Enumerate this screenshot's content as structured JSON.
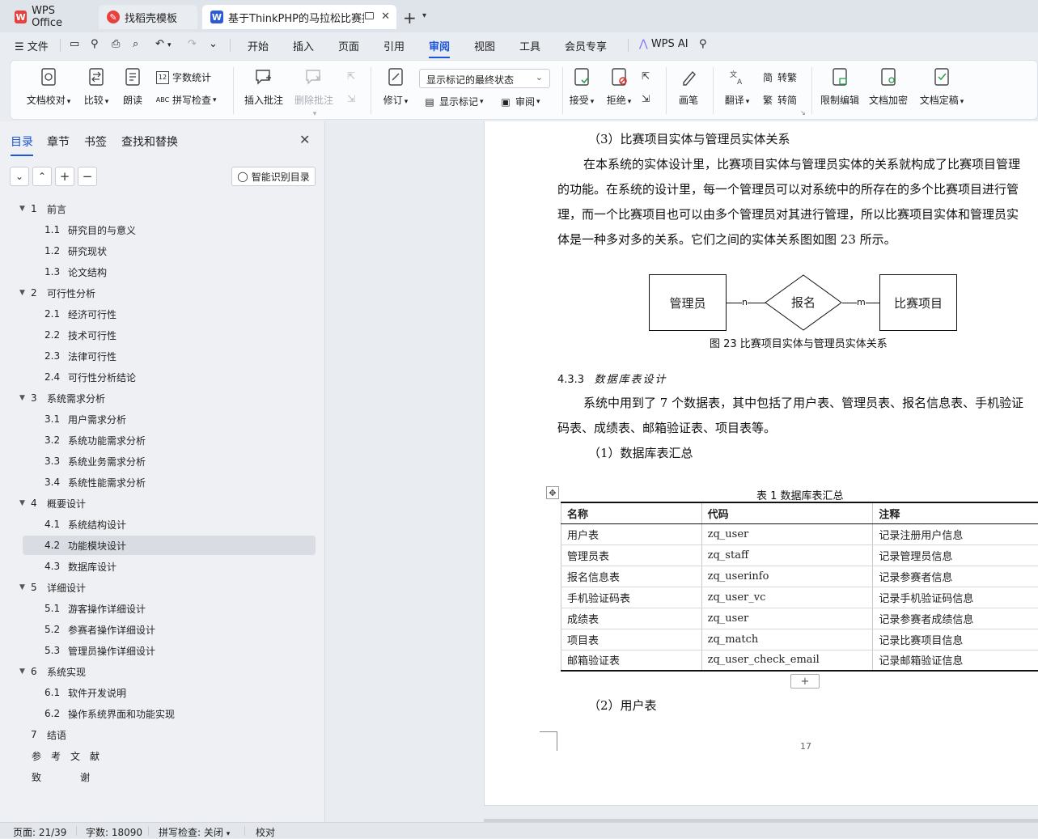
{
  "tabs": [
    {
      "label": "WPS Office",
      "icon": "wps-logo-icon",
      "color": "#e8413c"
    },
    {
      "label": "找稻壳模板",
      "icon": "docer-icon",
      "color": "#e8413c"
    },
    {
      "label": "基于ThinkPHP的马拉松比赛报",
      "icon": "word-doc-icon",
      "color": "#2b5bd7"
    }
  ],
  "menu": {
    "file": "文件",
    "items": [
      "开始",
      "插入",
      "页面",
      "引用",
      "审阅",
      "视图",
      "工具",
      "会员专享"
    ],
    "active": "审阅",
    "ai": "WPS AI"
  },
  "ribbon": {
    "doc_check": "文档校对",
    "compare": "比较",
    "read_aloud": "朗读",
    "word_count": "字数统计",
    "spell_check": "拼写检查",
    "insert_comment": "插入批注",
    "delete_comment": "删除批注",
    "revise": "修订",
    "markup_state": "显示标记的最终状态",
    "show_markup": "显示标记",
    "review": "审阅",
    "accept": "接受",
    "reject": "拒绝",
    "pen": "画笔",
    "translate": "翻译",
    "to_traditional": "转繁",
    "to_simplified": "转简",
    "restrict_edit": "限制编辑",
    "encrypt": "文档加密",
    "finalize": "文档定稿"
  },
  "nav": {
    "tabs": [
      "目录",
      "章节",
      "书签",
      "查找和替换"
    ],
    "active_tab": "目录",
    "smart_button": "智能识别目录",
    "toc": [
      {
        "num": "1",
        "label": "前言",
        "level": 1,
        "expanded": true
      },
      {
        "num": "1.1",
        "label": "研究目的与意义",
        "level": 2
      },
      {
        "num": "1.2",
        "label": "研究现状",
        "level": 2
      },
      {
        "num": "1.3",
        "label": "论文结构",
        "level": 2
      },
      {
        "num": "2",
        "label": "可行性分析",
        "level": 1,
        "expanded": true
      },
      {
        "num": "2.1",
        "label": "经济可行性",
        "level": 2
      },
      {
        "num": "2.2",
        "label": "技术可行性",
        "level": 2
      },
      {
        "num": "2.3",
        "label": "法律可行性",
        "level": 2
      },
      {
        "num": "2.4",
        "label": "可行性分析结论",
        "level": 2
      },
      {
        "num": "3",
        "label": "系统需求分析",
        "level": 1,
        "expanded": true
      },
      {
        "num": "3.1",
        "label": "用户需求分析",
        "level": 2
      },
      {
        "num": "3.2",
        "label": "系统功能需求分析",
        "level": 2
      },
      {
        "num": "3.3",
        "label": "系统业务需求分析",
        "level": 2
      },
      {
        "num": "3.4",
        "label": "系统性能需求分析",
        "level": 2
      },
      {
        "num": "4",
        "label": "概要设计",
        "level": 1,
        "expanded": true
      },
      {
        "num": "4.1",
        "label": "系统结构设计",
        "level": 2
      },
      {
        "num": "4.2",
        "label": "功能模块设计",
        "level": 2,
        "selected": true
      },
      {
        "num": "4.3",
        "label": "数据库设计",
        "level": 2
      },
      {
        "num": "5",
        "label": "详细设计",
        "level": 1,
        "expanded": true
      },
      {
        "num": "5.1",
        "label": "游客操作详细设计",
        "level": 2
      },
      {
        "num": "5.2",
        "label": "参赛者操作详细设计",
        "level": 2
      },
      {
        "num": "5.3",
        "label": "管理员操作详细设计",
        "level": 2
      },
      {
        "num": "6",
        "label": "系统实现",
        "level": 1,
        "expanded": true
      },
      {
        "num": "6.1",
        "label": "软件开发说明",
        "level": 2
      },
      {
        "num": "6.2",
        "label": "操作系统界面和功能实现",
        "level": 2
      },
      {
        "num": "7",
        "label": "结语",
        "level": 1
      },
      {
        "num": "",
        "label": "参　考　文　献",
        "level": 1
      },
      {
        "num": "",
        "label": "致　　　　谢",
        "level": 1
      }
    ]
  },
  "document": {
    "section_title": "（3）比赛项目实体与管理员实体关系",
    "para1": [
      "在本系统的实体设计里，比赛项目实体与管理员实体的关系就构成了比赛项目管理",
      "的功能。在系统的设计里，每一个管理员可以对系统中的所存在的多个比赛项目进行管",
      "理，而一个比赛项目也可以由多个管理员对其进行管理，所以比赛项目实体和管理员实",
      "体是一种多对多的关系。它们之间的实体关系图如图 23 所示。"
    ],
    "er": {
      "entity_left": "管理员",
      "relation": "报名",
      "entity_right": "比赛项目",
      "card_left": "n",
      "card_right": "m"
    },
    "figure_caption": "图 23  比赛项目实体与管理员实体关系",
    "heading_num": "4.3.3",
    "heading_text": "数据库表设计",
    "para2": [
      "系统中用到了 7 个数据表，其中包括了用户表、管理员表、报名信息表、手机验证",
      "码表、成绩表、邮箱验证表、项目表等。"
    ],
    "sub1": "（1）数据库表汇总",
    "table_caption": "表 1  数据库表汇总",
    "table": {
      "headers": [
        "名称",
        "代码",
        "注释"
      ],
      "rows": [
        [
          "用户表",
          "zq_user",
          "记录注册用户信息"
        ],
        [
          "管理员表",
          "zq_staff",
          "记录管理员信息"
        ],
        [
          "报名信息表",
          "zq_userinfo",
          "记录参赛者信息"
        ],
        [
          "手机验证码表",
          "zq_user_vc",
          "记录手机验证码信息"
        ],
        [
          "成绩表",
          "zq_user",
          "记录参赛者成绩信息"
        ],
        [
          "项目表",
          "zq_match",
          "记录比赛项目信息"
        ],
        [
          "邮箱验证表",
          "zq_user_check_email",
          "记录邮箱验证信息"
        ]
      ]
    },
    "sub2": "（2）用户表",
    "page_number": "17"
  },
  "status": {
    "page": "页面: 21/39",
    "words": "字数: 18090",
    "spell": "拼写检查: 关闭",
    "proof": "校对"
  }
}
